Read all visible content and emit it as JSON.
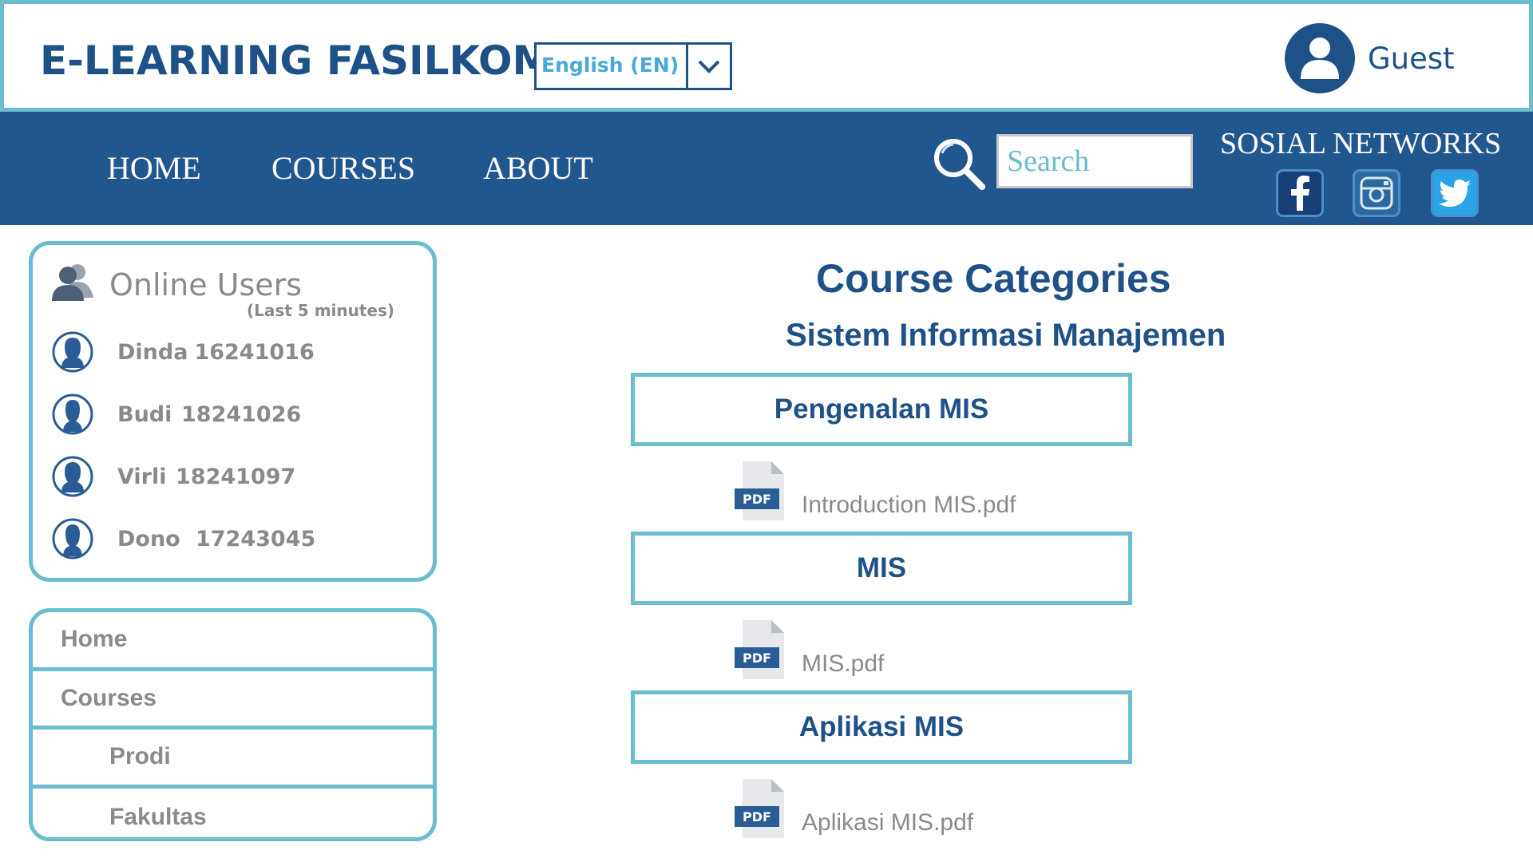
{
  "header": {
    "brand": "E-LEARNING FASILKOM",
    "language": "English (EN)",
    "user_name": "Guest"
  },
  "nav": {
    "links": [
      "HOME",
      "COURSES",
      "ABOUT"
    ],
    "search_placeholder": "Search",
    "social_title": "SOSIAL NETWORKS",
    "social_icons": [
      "facebook-icon",
      "instagram-icon",
      "twitter-icon"
    ]
  },
  "online_users": {
    "title": "Online Users",
    "subtitle": "(Last 5 minutes)",
    "users": [
      {
        "name": "Dinda",
        "id": "16241016"
      },
      {
        "name": "Budi",
        "id": "18241026"
      },
      {
        "name": "Virli",
        "id": "18241097"
      },
      {
        "name": "Dono",
        "id": "17243045"
      }
    ]
  },
  "side_menu": {
    "items": [
      "Home",
      "Courses",
      "Prodi",
      "Fakultas"
    ]
  },
  "main": {
    "title": "Course Categories",
    "subtitle": "Sistem Informasi Manajemen",
    "courses": [
      {
        "name": "Pengenalan MIS",
        "file": "Introduction MIS.pdf"
      },
      {
        "name": "MIS",
        "file": "MIS.pdf"
      },
      {
        "name": "Aplikasi MIS",
        "file": "Aplikasi MIS.pdf"
      }
    ],
    "file_badge": "PDF"
  },
  "colors": {
    "primary": "#1f5189",
    "accent": "#6bbccf",
    "nav_bg": "#21578f",
    "muted_text": "#8a8a8a"
  }
}
